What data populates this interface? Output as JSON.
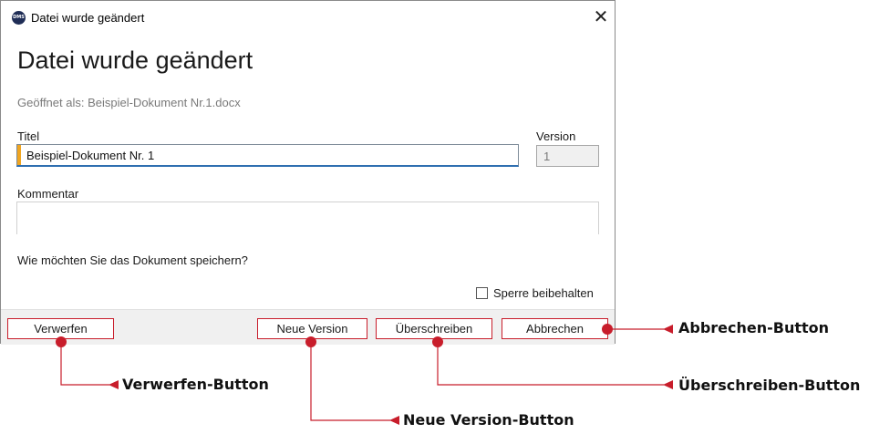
{
  "window": {
    "app_icon_text": "DMS",
    "title": "Datei wurde geändert",
    "close_glyph": "✕"
  },
  "dialog": {
    "heading": "Datei wurde geändert",
    "opened_as": "Geöffnet als:  Beispiel-Dokument Nr.1.docx",
    "title_label": "Titel",
    "title_value": "Beispiel-Dokument Nr. 1",
    "version_label": "Version",
    "version_value": "1",
    "comment_label": "Kommentar",
    "comment_value": "",
    "question": "Wie möchten Sie das Dokument speichern?",
    "keep_lock_label": "Sperre beibehalten",
    "keep_lock_checked": false
  },
  "buttons": {
    "discard": "Verwerfen",
    "new_version": "Neue Version",
    "overwrite": "Überschreiben",
    "cancel": "Abbrechen"
  },
  "annotations": {
    "cancel": "Abbrechen-Button",
    "discard": "Verwerfen-Button",
    "overwrite": "Überschreiben-Button",
    "new_version": "Neue Version-Button"
  },
  "colors": {
    "annotation_red": "#c81d2b",
    "title_accent": "#f0a520",
    "focus_blue": "#2f6fb0",
    "app_icon_bg": "#1f2d56"
  }
}
